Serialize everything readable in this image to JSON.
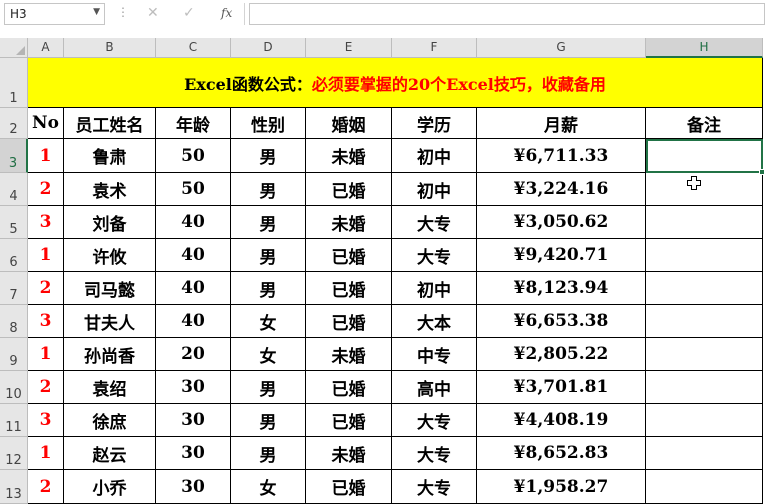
{
  "name_box": {
    "value": "H3"
  },
  "formula_bar": {
    "fx_label": "fx",
    "value": ""
  },
  "columns": [
    "A",
    "B",
    "C",
    "D",
    "E",
    "F",
    "G",
    "H"
  ],
  "rows": [
    "1",
    "2",
    "3",
    "4",
    "5",
    "6",
    "7",
    "8",
    "9",
    "10",
    "11",
    "12",
    "13"
  ],
  "title": {
    "part1": "Excel函数公式：",
    "part2": "必须要掌握的20个Excel技巧，收藏备用"
  },
  "table": {
    "headers": [
      "No",
      "员工姓名",
      "年龄",
      "性别",
      "婚姻",
      "学历",
      "月薪",
      "备注"
    ],
    "rows": [
      [
        "1",
        "鲁肃",
        "50",
        "男",
        "未婚",
        "初中",
        "¥6,711.33",
        ""
      ],
      [
        "2",
        "袁术",
        "50",
        "男",
        "已婚",
        "初中",
        "¥3,224.16",
        ""
      ],
      [
        "3",
        "刘备",
        "40",
        "男",
        "未婚",
        "大专",
        "¥3,050.62",
        ""
      ],
      [
        "1",
        "许攸",
        "40",
        "男",
        "已婚",
        "大专",
        "¥9,420.71",
        ""
      ],
      [
        "2",
        "司马懿",
        "40",
        "男",
        "已婚",
        "初中",
        "¥8,123.94",
        ""
      ],
      [
        "3",
        "甘夫人",
        "40",
        "女",
        "已婚",
        "大本",
        "¥6,653.38",
        ""
      ],
      [
        "1",
        "孙尚香",
        "20",
        "女",
        "未婚",
        "中专",
        "¥2,805.22",
        ""
      ],
      [
        "2",
        "袁绍",
        "30",
        "男",
        "已婚",
        "高中",
        "¥3,701.81",
        ""
      ],
      [
        "3",
        "徐庶",
        "30",
        "男",
        "已婚",
        "大专",
        "¥4,408.19",
        ""
      ],
      [
        "1",
        "赵云",
        "30",
        "男",
        "未婚",
        "大专",
        "¥8,652.83",
        ""
      ],
      [
        "2",
        "小乔",
        "30",
        "女",
        "已婚",
        "大专",
        "¥1,958.27",
        ""
      ]
    ]
  },
  "selected_cell": "H3",
  "colors": {
    "title_bg": "#ffff00",
    "title_highlight": "#ff0000",
    "no_column": "#ff0000",
    "selection": "#217346"
  },
  "icons": [
    "dropdown-arrow-icon",
    "cancel-icon",
    "enter-icon",
    "fx-icon",
    "cross-cursor-icon"
  ]
}
